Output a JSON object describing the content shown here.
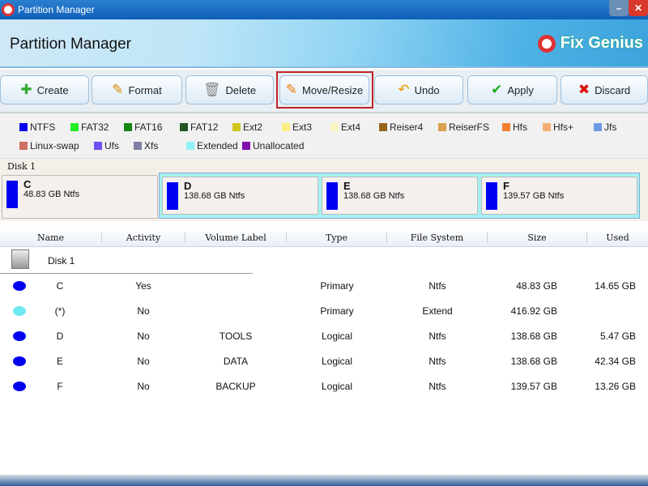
{
  "window": {
    "title": "Partition Manager"
  },
  "header": {
    "title": "Partition Manager",
    "brand": "Fix Genius"
  },
  "toolbar": [
    {
      "label": "Create",
      "icon": "create-icon",
      "glyph": "✚",
      "color": "#3a3"
    },
    {
      "label": "Format",
      "icon": "format-icon",
      "glyph": "✎",
      "color": "#d80"
    },
    {
      "label": "Delete",
      "icon": "delete-icon",
      "glyph": "🗑",
      "color": "#888"
    },
    {
      "label": "Move/Resize",
      "icon": "move-resize-icon",
      "glyph": "✎",
      "color": "#e70",
      "selected": true
    },
    {
      "label": "Undo",
      "icon": "undo-icon",
      "glyph": "↶",
      "color": "#e90"
    },
    {
      "label": "Apply",
      "icon": "check-icon",
      "glyph": "✔",
      "color": "#2a2"
    },
    {
      "label": "Discard",
      "icon": "x-icon",
      "glyph": "✖",
      "color": "#d11"
    }
  ],
  "legend": [
    {
      "label": "NTFS",
      "color": "#0000f0"
    },
    {
      "label": "FAT32",
      "color": "#22ee22"
    },
    {
      "label": "FAT16",
      "color": "#118811"
    },
    {
      "label": "FAT12",
      "color": "#225522"
    },
    {
      "label": "Ext2",
      "color": "#d4c420"
    },
    {
      "label": "Ext3",
      "color": "#f8f080"
    },
    {
      "label": "Ext4",
      "color": "#fbf4c0"
    },
    {
      "label": "Reiser4",
      "color": "#9a6420"
    },
    {
      "label": "ReiserFS",
      "color": "#dca050"
    },
    {
      "label": "Hfs",
      "color": "#f08030"
    },
    {
      "label": "Hfs+",
      "color": "#f4b070"
    },
    {
      "label": "Jfs",
      "color": "#6a9ae8"
    },
    {
      "label": "Linux-swap",
      "color": "#d07060"
    },
    {
      "label": "Ufs",
      "color": "#7050f0"
    },
    {
      "label": "Xfs",
      "color": "#8080a0"
    },
    {
      "label": "Extended",
      "color": "#90f4f4"
    },
    {
      "label": "Unallocated",
      "color": "#8010b0"
    }
  ],
  "disk_map": {
    "label": "Disk 1",
    "partitions": [
      {
        "letter": "C",
        "desc": "48.83 GB Ntfs"
      },
      {
        "letter": "D",
        "desc": "138.68 GB Ntfs"
      },
      {
        "letter": "E",
        "desc": "138.68 GB Ntfs"
      },
      {
        "letter": "F",
        "desc": "139.57 GB Ntfs"
      }
    ]
  },
  "table": {
    "columns": [
      "Name",
      "Activity",
      "Volume Label",
      "Type",
      "File System",
      "Size",
      "Used"
    ],
    "disk": "Disk 1",
    "rows": [
      {
        "name": "C",
        "activity": "Yes",
        "label": "",
        "type": "Primary",
        "fs": "Ntfs",
        "size": "48.83 GB",
        "used": "14.65 GB",
        "color": "#0000f0"
      },
      {
        "name": "(*)",
        "activity": "No",
        "label": "",
        "type": "Primary",
        "fs": "Extend",
        "size": "416.92 GB",
        "used": "",
        "color": "#70e8f0"
      },
      {
        "name": "D",
        "activity": "No",
        "label": "TOOLS",
        "type": "Logical",
        "fs": "Ntfs",
        "size": "138.68 GB",
        "used": "5.47 GB",
        "color": "#0000f0"
      },
      {
        "name": "E",
        "activity": "No",
        "label": "DATA",
        "type": "Logical",
        "fs": "Ntfs",
        "size": "138.68 GB",
        "used": "42.34 GB",
        "color": "#0000f0"
      },
      {
        "name": "F",
        "activity": "No",
        "label": "BACKUP",
        "type": "Logical",
        "fs": "Ntfs",
        "size": "139.57 GB",
        "used": "13.26 GB",
        "color": "#0000f0"
      }
    ]
  }
}
